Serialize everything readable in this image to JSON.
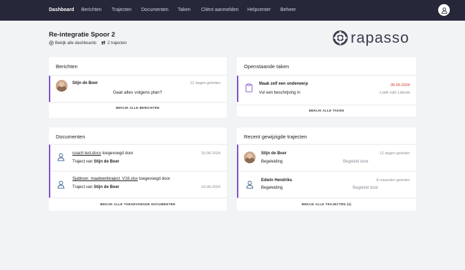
{
  "nav": {
    "items": [
      "Dashboard",
      "Berichten",
      "Trajecten",
      "Documenten",
      "Taken",
      "Cliënt aanmelden",
      "Helpcenter",
      "Beheer"
    ]
  },
  "header": {
    "title": "Re-integratie Spoor 2",
    "all_dashboards": "Bekijk alle dashboards",
    "trajects": "2 trajecten"
  },
  "logo": {
    "text": "rapasso"
  },
  "berichten": {
    "title": "Berichten",
    "sender": "Stijn de Boer",
    "time": "12 dagen geleden",
    "message": "Gaat alles volgens plan?",
    "footer": "BEKIJK ALLE BERICHTEN"
  },
  "taken": {
    "title": "Openstaande taken",
    "task_title": "Maak zelf een onderwerp",
    "date": "05-06-2024",
    "description": "Vul een beschrijving in",
    "assignee": "Loek van Leeuw",
    "footer": "BEKIJK ALLE TAKEN"
  },
  "documenten": {
    "title": "Documenten",
    "items": [
      {
        "file": "coach test.docx",
        "action": "toegevoegd door",
        "date": "19-06-2024",
        "traject_prefix": "Traject van",
        "traject_person": "Stijn de Boer"
      },
      {
        "file": "Sjabloon_maatwerktraject_V16.xlsx",
        "action": "toegevoegd door",
        "date": "19-06-2024",
        "traject_prefix": "Traject van",
        "traject_person": "Stijn de Boer"
      }
    ],
    "footer": "BEKIJK ALLE TOEGEVOEGDE DOCUMENTEN"
  },
  "trajecten": {
    "title": "Recent gewijzigde trajecten",
    "items": [
      {
        "name": "Stijn de Boer",
        "time": "12 dagen geleden",
        "role": "Begeleiding",
        "guided_by": "Begeleid door"
      },
      {
        "name": "Edwin Hendriks",
        "time": "8 maanden geleden",
        "role": "Begeleiding",
        "guided_by": "Begeleid door"
      }
    ],
    "footer": "BEKIJK ALLE TRAJECTEN (2)"
  },
  "colors": {
    "nav_bg": "#26283a",
    "accent": "#7d4ec7",
    "danger": "#d0302b",
    "page_bg": "#f2f3f5"
  }
}
